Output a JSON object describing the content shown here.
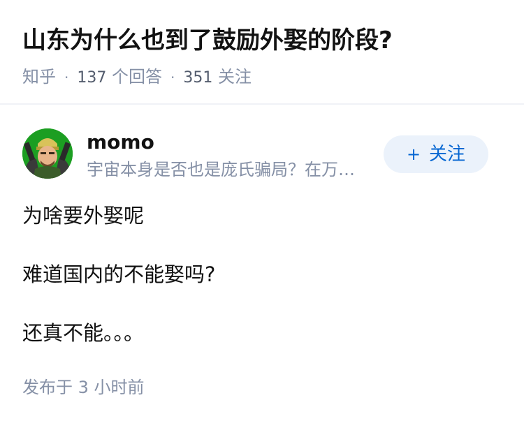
{
  "question": {
    "title": "山东为什么也到了鼓励外娶的阶段?",
    "source": "知乎",
    "answer_count": "137",
    "answer_label": "个回答",
    "follower_count": "351",
    "follower_label": "关注",
    "separator": "·"
  },
  "author": {
    "name": "momo",
    "bio": "宇宙本身是否也是庞氏骗局？在万…",
    "avatar_icon": "cartoon-character-avatar-icon",
    "follow_label": "关注",
    "follow_plus": "+"
  },
  "answer": {
    "paragraphs": [
      "为啥要外娶呢",
      "难道国内的不能娶吗?",
      "还真不能。。。"
    ],
    "posted_time": "发布于 3 小时前"
  },
  "colors": {
    "accent": "#0566d2",
    "follow_bg": "#ebf2fb",
    "meta": "#8590a6",
    "text": "#121212"
  }
}
